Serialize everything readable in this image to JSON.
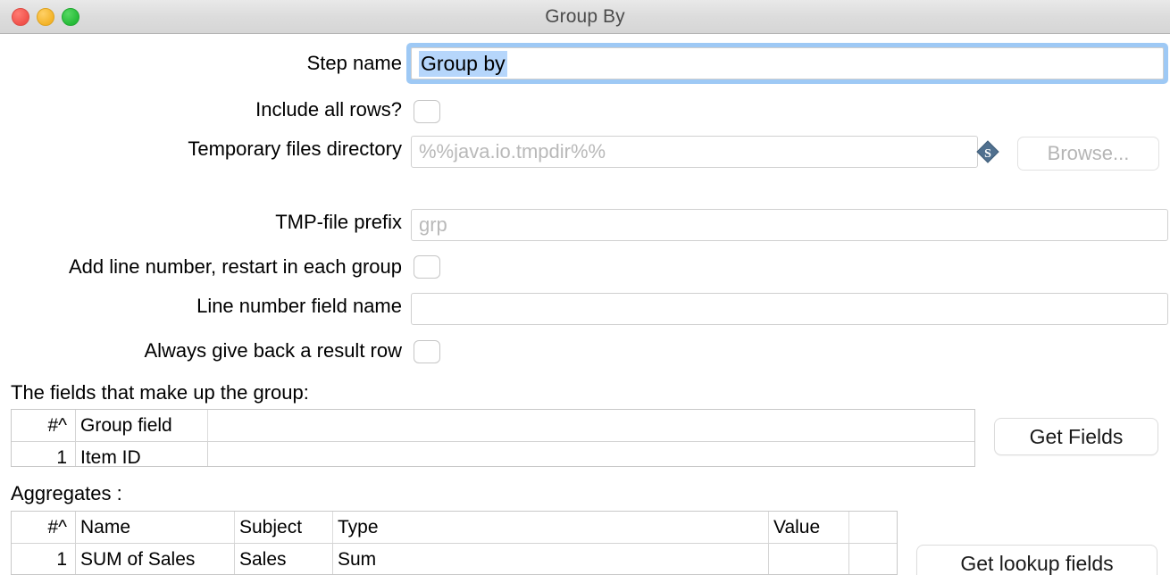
{
  "window": {
    "title": "Group By",
    "controls": {
      "close": "close",
      "minimize": "minimize",
      "zoom": "zoom"
    }
  },
  "form": {
    "step_name": {
      "label": "Step name",
      "value": "Group by",
      "selected": true
    },
    "include_all_rows": {
      "label": "Include all rows?",
      "checked": false
    },
    "temp_dir": {
      "label": "Temporary files directory",
      "value": "",
      "placeholder": "%%java.io.tmpdir%%",
      "variable_icon": "variable-dollar-diamond-icon",
      "browse_label": "Browse...",
      "browse_disabled": true
    },
    "tmp_prefix": {
      "label": "TMP-file prefix",
      "value": "",
      "placeholder": "grp"
    },
    "add_line_number": {
      "label": "Add line number, restart in each group",
      "checked": false
    },
    "line_number_field": {
      "label": "Line number field name",
      "value": "",
      "placeholder": ""
    },
    "always_give_back": {
      "label": "Always give back a result row",
      "checked": false
    }
  },
  "group_fields": {
    "title": "The fields that make up the group:",
    "columns": [
      "#^",
      "Group field",
      ""
    ],
    "rows": [
      {
        "index": "1",
        "group_field": "Item ID",
        "extra": ""
      }
    ],
    "button": "Get Fields"
  },
  "aggregates": {
    "title": "Aggregates :",
    "columns": [
      "#^",
      "Name",
      "Subject",
      "Type",
      "Value",
      ""
    ],
    "rows": [
      {
        "index": "1",
        "name": "SUM of Sales",
        "subject": "Sales",
        "type": "Sum",
        "value": "",
        "extra": ""
      }
    ],
    "button": "Get lookup fields"
  },
  "colors": {
    "focus_ring": "#9ec9f5",
    "selection": "#b6d6fb",
    "titlebar_text": "#4c4c4c",
    "placeholder": "#b9b9b9",
    "variable_icon": "#50708f"
  }
}
